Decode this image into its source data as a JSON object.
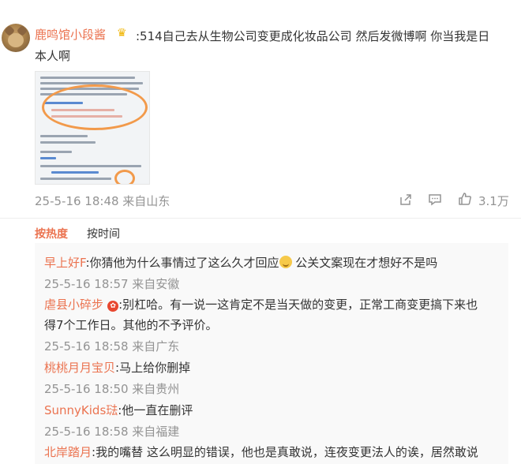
{
  "post": {
    "author": "鹿鸣馆小段酱",
    "text_line1": ":514自己去从生物公司变更成化妆品公司 然后发微博啊 你当我是日",
    "text_line2": "本人啊",
    "meta": "25-5-16 18:48 来自山东",
    "like_count": "3.1万"
  },
  "sort_tabs": {
    "hot": "按热度",
    "time": "按时间"
  },
  "replies": [
    {
      "user": "早上好F",
      "text": ":你猜他为什么事情过了这么久才回应",
      "text_after": " 公关文案现在才想好不是吗",
      "meta": "25-5-16 18:57 来自安徽"
    },
    {
      "user": "虐县小碎步",
      "text": ":别杠哈。有一说一这肯定不是当天做的变更，正常工商变更搞下来也",
      "text2": "得7个工作日。其他的不予评价。",
      "meta": "25-5-16 18:58 来自广东"
    },
    {
      "user": "桃桃月月宝贝",
      "text": ":马上给你删掉",
      "meta": "25-5-16 18:50 来自贵州"
    },
    {
      "user": "SunnyKids琺",
      "text": ":他一直在删评",
      "meta": "25-5-16 18:58 来自福建"
    },
    {
      "user": "北岸踏月",
      "text": ":我的嘴替 这么明显的错误，他也是真敢说，连夜变更法人的诶，居然敢说"
    }
  ],
  "colors": {
    "username": "#eb7350",
    "meta": "#939393",
    "text": "#333333",
    "accent_orange": "#f29a4b"
  }
}
